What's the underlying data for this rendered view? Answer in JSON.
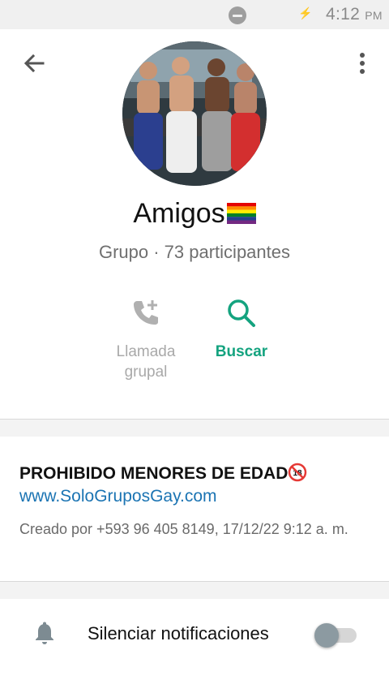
{
  "status_bar": {
    "time": "4:12",
    "ampm": "PM"
  },
  "header": {
    "back_icon": "arrow-left-icon",
    "menu_icon": "more-vertical-icon"
  },
  "profile": {
    "name": "Amigos",
    "subtitle": "Grupo · 73 participantes"
  },
  "actions": [
    {
      "icon": "add-call-icon",
      "label_line1": "Llamada",
      "label_line2": "grupal",
      "color": "#a9a9a9"
    },
    {
      "icon": "search-icon",
      "label": "Buscar",
      "color": "#14a37f"
    }
  ],
  "description": {
    "title": "PROHIBIDO MENORES DE EDAD",
    "link": "www.SoloGruposGay.com",
    "created": "Creado por +593 96 405 8149, 17/12/22 9:12 a. m."
  },
  "notifications": {
    "icon": "bell-icon",
    "label": "Silenciar notificaciones",
    "enabled": false
  },
  "colors": {
    "accent": "#14a37f",
    "link": "#1b74b3"
  }
}
